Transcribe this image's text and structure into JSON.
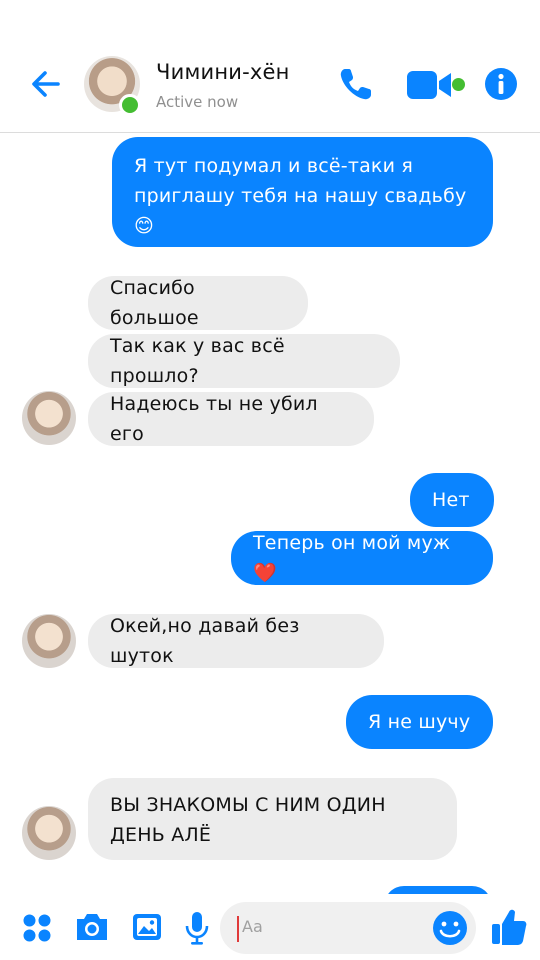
{
  "header": {
    "contact_name": "Чимини-хён",
    "status": "Active now",
    "colors": {
      "accent": "#0a84ff",
      "online": "#44bd32"
    },
    "icons": [
      "back-arrow-icon",
      "phone-icon",
      "video-camera-icon",
      "info-icon"
    ]
  },
  "messages": [
    {
      "side": "out",
      "text": "Я тут подумал и всё-таки я приглашу тебя на нашу свадьбу 😊"
    },
    {
      "side": "in",
      "text": "Спасибо большое"
    },
    {
      "side": "in",
      "text": "Так как у вас всё прошло?"
    },
    {
      "side": "in",
      "text": "Надеюсь ты не убил его"
    },
    {
      "side": "out",
      "text": "Нет"
    },
    {
      "side": "out",
      "text": "Теперь он мой муж❤️"
    },
    {
      "side": "in",
      "text": "Окей,но давай без шуток"
    },
    {
      "side": "out",
      "text": "Я не шучу"
    },
    {
      "side": "in",
      "text": "ВЫ ЗНАКОМЫ С НИМ ОДИН ДЕНЬ АЛЁ"
    }
  ],
  "composer": {
    "placeholder": "Aa",
    "icons": [
      "apps-icon",
      "camera-icon",
      "gallery-icon",
      "microphone-icon",
      "emoji-icon",
      "like-thumb-icon"
    ]
  }
}
